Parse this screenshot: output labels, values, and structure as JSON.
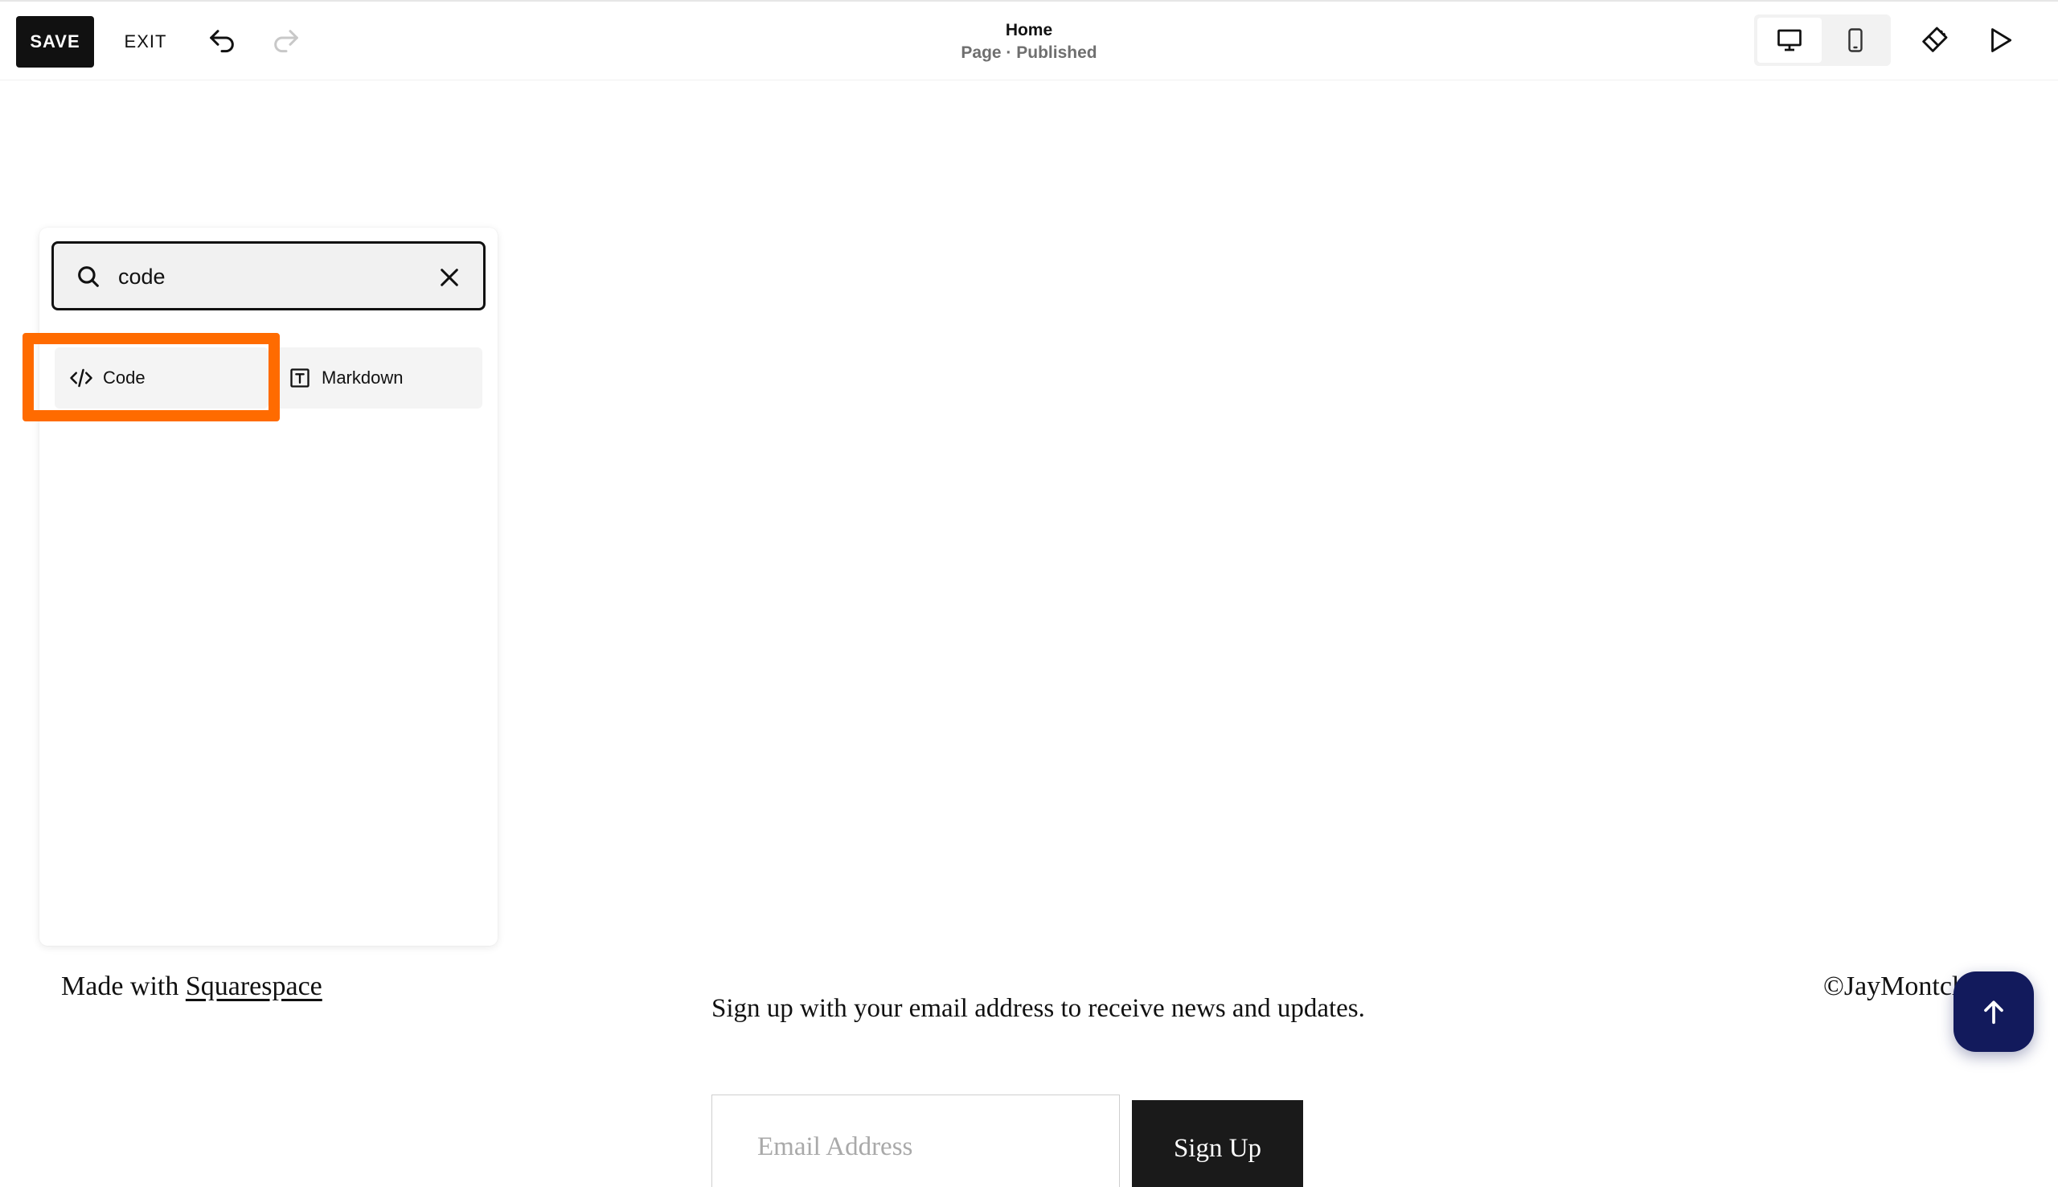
{
  "toolbar": {
    "save_label": "SAVE",
    "exit_label": "EXIT",
    "undo_icon": "undo-icon",
    "redo_icon": "redo-icon",
    "page_title": "Home",
    "page_status": "Page · Published",
    "device_desktop_icon": "desktop-icon",
    "device_mobile_icon": "mobile-icon",
    "site_styles_icon": "paintbrush-icon",
    "preview_icon": "play-icon",
    "active_device": "desktop"
  },
  "block_picker": {
    "search": {
      "value": "code",
      "icon": "search-icon",
      "clear_icon": "close-icon"
    },
    "results": [
      {
        "label": "Code",
        "icon": "code-icon"
      },
      {
        "label": "Markdown",
        "icon": "markdown-icon"
      }
    ],
    "highlight_color": "#ff6b00"
  },
  "footer": {
    "made_with_prefix": "Made with",
    "made_with_link": "Squarespace",
    "newsletter_text": "Sign up with your email address to receive news and updates.",
    "email_placeholder": "Email Address",
    "signup_label": "Sign Up",
    "copyright": "©JayMontcl",
    "scroll_top_icon": "arrow-up-icon",
    "scroll_top_color": "#121a5c"
  }
}
